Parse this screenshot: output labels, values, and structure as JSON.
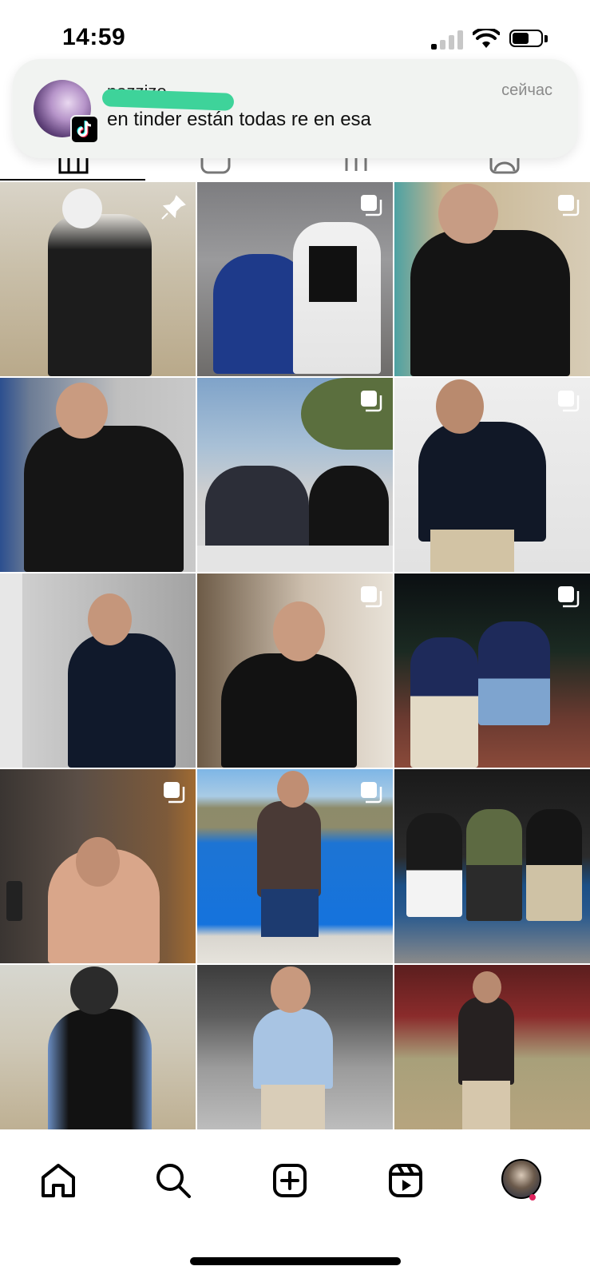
{
  "status_bar": {
    "time": "14:59"
  },
  "notification": {
    "sender": "nazzizo",
    "time": "сейчас",
    "message": "en tinder están todas re en esa",
    "app_icon": "tiktok-icon"
  },
  "profile_tabs": [
    "grid-icon",
    "video-icon",
    "reels-grid-icon",
    "tagged-icon"
  ],
  "grid": {
    "posts": [
      {
        "icon": "pin-icon"
      },
      {
        "icon": "multiple-posts-icon"
      },
      {
        "icon": "multiple-posts-icon"
      },
      {
        "icon": null
      },
      {
        "icon": "multiple-posts-icon"
      },
      {
        "icon": "multiple-posts-icon"
      },
      {
        "icon": null
      },
      {
        "icon": "multiple-posts-icon"
      },
      {
        "icon": "multiple-posts-icon"
      },
      {
        "icon": "multiple-posts-icon"
      },
      {
        "icon": "multiple-posts-icon"
      },
      {
        "icon": null
      },
      {
        "icon": null
      },
      {
        "icon": null
      },
      {
        "icon": null
      }
    ]
  },
  "bottom_nav": [
    "home-icon",
    "search-icon",
    "create-icon",
    "reels-icon",
    "profile-avatar"
  ],
  "colors": {
    "notification_bg": "#f1f3f1",
    "redaction": "#3ed39a",
    "notification_dot": "#e0245e"
  }
}
